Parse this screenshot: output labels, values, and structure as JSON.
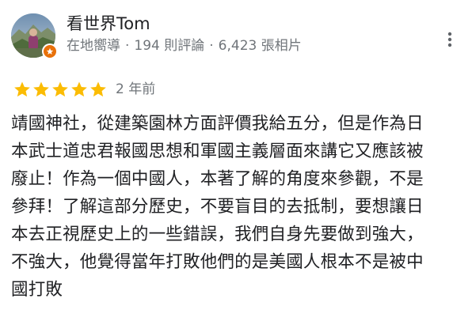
{
  "reviewer": {
    "name": "看世界Tom",
    "role": "在地嚮導",
    "review_count": "194 則評論",
    "photo_count": "6,423 張相片",
    "separator": "·",
    "avatar_icon": "profile-photo-icon",
    "badge_icon": "local-guide-badge-icon",
    "badge_color": "#e8710a"
  },
  "review": {
    "rating": 5,
    "max_rating": 5,
    "star_color": "#fbbc04",
    "time_ago": "2 年前",
    "lines": [
      "靖國神社，從建築園林方面評價我給五分，但是作為日",
      "本武士道忠君報國思想和軍國主義層面來講它又應該被",
      "廢止！作為一個中國人，本著了解的角度來參觀，不是",
      "參拜！了解這部分歷史，不要盲目的去抵制，要想讓日",
      "本去正視歷史上的一些錯誤，我們自身先要做到強大，",
      "不強大，他覺得當年打敗他們的是美國人根本不是被中",
      "國打敗"
    ]
  },
  "menu": {
    "icon": "more-vert-icon"
  }
}
